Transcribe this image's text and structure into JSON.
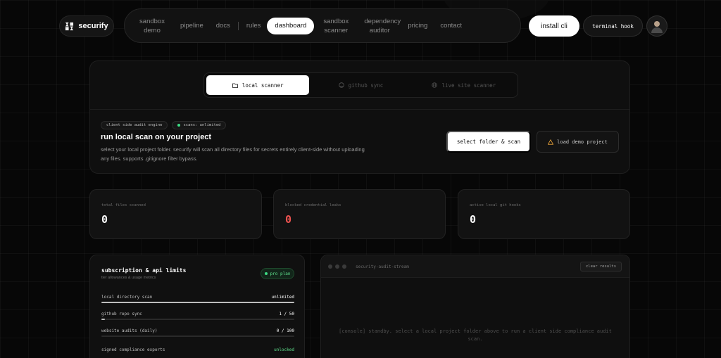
{
  "app": {
    "name": "securify"
  },
  "nav": {
    "items": [
      {
        "label": "sandbox demo",
        "two": true
      },
      {
        "label": "pipeline"
      },
      {
        "label": "docs"
      },
      {
        "sep": true
      },
      {
        "label": "rules"
      },
      {
        "label": "dashboard",
        "active": true
      },
      {
        "label": "sandbox scanner",
        "two": true
      },
      {
        "label": "dependency auditor",
        "two": true
      },
      {
        "label": "pricing"
      },
      {
        "label": "contact"
      }
    ],
    "install_label": "install cli",
    "terminal_hook_label": "terminal hook"
  },
  "scanner": {
    "tabs": [
      {
        "label": "local scanner",
        "icon": "folder-icon",
        "active": true
      },
      {
        "label": "github sync",
        "icon": "github-icon"
      },
      {
        "label": "live site scanner",
        "icon": "globe-icon"
      }
    ],
    "chips": [
      "client side audit engine",
      "scans: unlimited"
    ],
    "title": "run local scan on your project",
    "description": "select your local project folder. securify will scan all directory files for secrets entirely client-side without uploading any files. supports .gitignore filter bypass.",
    "select_button": "select folder & scan",
    "demo_button": "load demo project"
  },
  "stats": [
    {
      "label": "total files scanned",
      "value": "0",
      "color": "#ffffff"
    },
    {
      "label": "blocked credential leaks",
      "value": "0",
      "color": "#ef5350"
    },
    {
      "label": "active local git hooks",
      "value": "0",
      "color": "#ffffff"
    }
  ],
  "subscription": {
    "title": "subscription & api limits",
    "subtitle": "tier allowances & usage metrics",
    "badge": "pro plan",
    "rows": [
      {
        "label": "local directory scan",
        "value": "unlimited",
        "fill": 1.0
      },
      {
        "label": "github repo sync",
        "value": "1 / 50",
        "fill": 0.02
      },
      {
        "label": "website audits (daily)",
        "value": "0 / 100",
        "fill": 0
      },
      {
        "label": "signed compliance exports",
        "value": "unlocked",
        "green": true
      }
    ]
  },
  "terminal": {
    "title": "security-audit-stream",
    "clear_button": "clear results",
    "message": "[console] standby. select a local project folder above to run a client side compliance audit scan."
  },
  "colors": {
    "accent_green": "#5fe08c",
    "danger": "#ef5350",
    "background": "#070707"
  }
}
